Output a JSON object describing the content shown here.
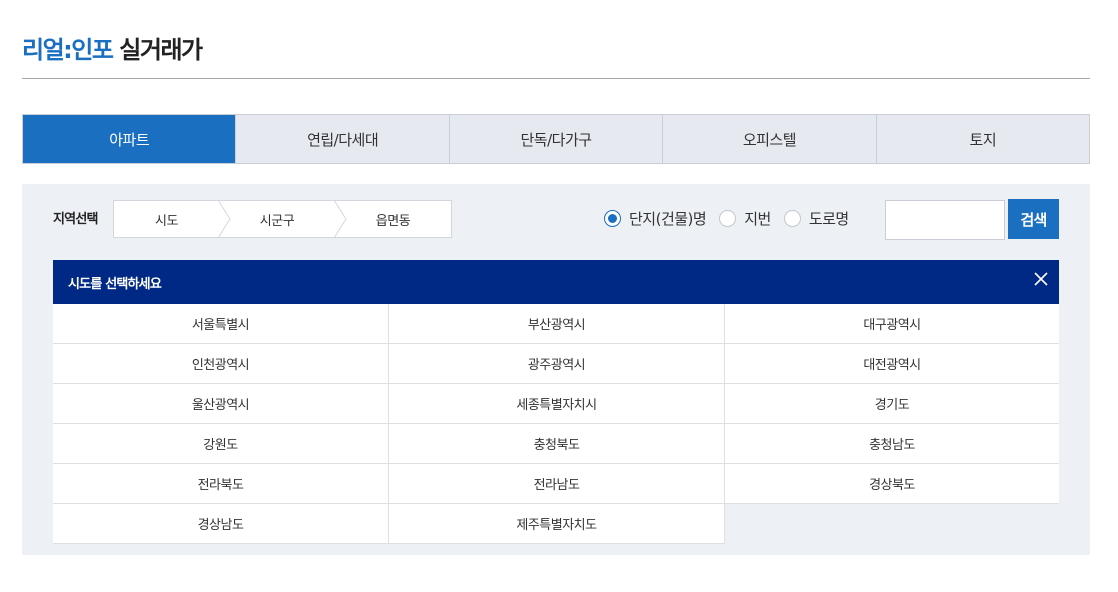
{
  "header": {
    "brand": "리얼:인포",
    "title": "실거래가"
  },
  "tabs": [
    {
      "label": "아파트",
      "active": true
    },
    {
      "label": "연립/다세대",
      "active": false
    },
    {
      "label": "단독/다가구",
      "active": false
    },
    {
      "label": "오피스텔",
      "active": false
    },
    {
      "label": "토지",
      "active": false
    }
  ],
  "region": {
    "label": "지역선택",
    "steps": [
      "시도",
      "시군구",
      "읍면동"
    ]
  },
  "search_type": {
    "options": [
      {
        "label": "단지(건물)명",
        "checked": true
      },
      {
        "label": "지번",
        "checked": false
      },
      {
        "label": "도로명",
        "checked": false
      }
    ]
  },
  "search": {
    "value": "",
    "button_label": "검색"
  },
  "popup": {
    "title": "시도를 선택하세요",
    "items": [
      "서울특별시",
      "부산광역시",
      "대구광역시",
      "인천광역시",
      "광주광역시",
      "대전광역시",
      "울산광역시",
      "세종특별자치시",
      "경기도",
      "강원도",
      "충청북도",
      "충청남도",
      "전라북도",
      "전라남도",
      "경상북도",
      "경상남도",
      "제주특별자치도"
    ]
  },
  "colors": {
    "accent": "#1a6fc0",
    "popup_header": "#002985",
    "panel_bg": "#edf1f5"
  }
}
